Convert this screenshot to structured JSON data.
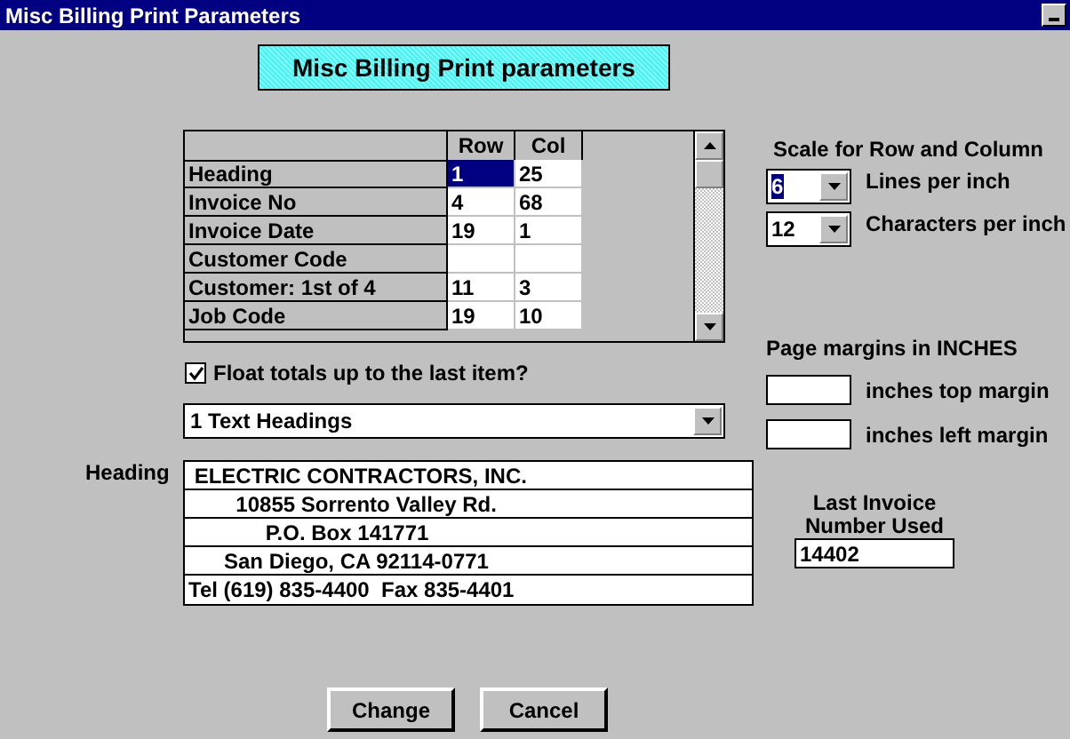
{
  "window": {
    "title": "Misc Billing Print Parameters"
  },
  "banner": "Misc Billing Print parameters",
  "grid": {
    "columns": [
      "Row",
      "Col"
    ],
    "rows": [
      {
        "label": "Heading",
        "row": "1",
        "col": "25",
        "selected": true
      },
      {
        "label": "Invoice No",
        "row": "4",
        "col": "68",
        "selected": false
      },
      {
        "label": "Invoice Date",
        "row": "19",
        "col": "1",
        "selected": false
      },
      {
        "label": "Customer Code",
        "row": "",
        "col": "",
        "selected": false
      },
      {
        "label": "Customer: 1st of 4",
        "row": "11",
        "col": "3",
        "selected": false
      },
      {
        "label": "Job Code",
        "row": "19",
        "col": "10",
        "selected": false
      }
    ]
  },
  "float_totals": {
    "label": "Float totals up to the last item?",
    "checked": true
  },
  "heading_type": {
    "value": "1 Text Headings"
  },
  "heading": {
    "label": "Heading",
    "lines": [
      " ELECTRIC CONTRACTORS, INC.",
      "        10855 Sorrento Valley Rd.",
      "             P.O. Box 141771",
      "      San Diego, CA 92114-0771",
      "Tel (619) 835-4400  Fax 835-4401"
    ]
  },
  "last_invoice": {
    "label": "Last Invoice Number Used",
    "value": "14402"
  },
  "scale": {
    "title": "Scale for Row and Column",
    "settings": [
      {
        "value": "6",
        "label": "Lines per inch",
        "selected": true
      },
      {
        "value": "12",
        "label": "Characters per inch",
        "selected": false
      }
    ]
  },
  "margins": {
    "title": "Page margins in INCHES",
    "fields": [
      {
        "label": "inches top margin"
      },
      {
        "label": "inches left margin"
      }
    ]
  },
  "buttons": [
    "Change",
    "Cancel"
  ]
}
